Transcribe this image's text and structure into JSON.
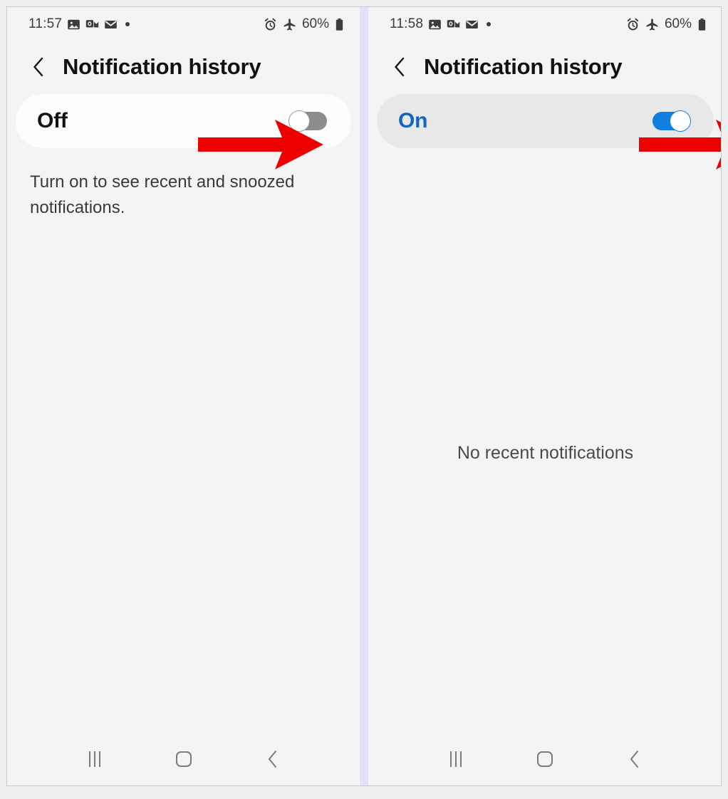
{
  "screenshot": {
    "description": "Two Android (Samsung One UI) phone screenshots side by side showing Notification history settings before and after enabling the toggle",
    "divider_color": "#e3e3f7",
    "accent_blue": "#0f7fe0",
    "arrow_color": "#ee0000"
  },
  "panels": [
    {
      "id": "left",
      "status_bar": {
        "time": "11:57",
        "icons": [
          "gallery-icon",
          "outlook-icon",
          "mail-icon",
          "dot-icon"
        ],
        "right_icons": [
          "alarm-icon",
          "airplane-mode-icon"
        ],
        "battery_percent": "60%",
        "battery_icon": "battery-icon"
      },
      "header": {
        "back_icon": "back-chevron-icon",
        "title": "Notification history"
      },
      "toggle_card": {
        "label": "Off",
        "state": "off",
        "card_background": "#fdfdfd",
        "label_color": "#121212",
        "track_color": "#8d8d8d"
      },
      "description": "Turn on to see recent and snoozed notifications.",
      "empty_state": "",
      "annotation_arrow": "red-arrow-pointing-to-toggle",
      "nav_bar": {
        "recents": "recents-icon",
        "home": "home-icon",
        "back": "back-icon"
      }
    },
    {
      "id": "right",
      "status_bar": {
        "time": "11:58",
        "icons": [
          "gallery-icon",
          "outlook-icon",
          "mail-icon",
          "dot-icon"
        ],
        "right_icons": [
          "alarm-icon",
          "airplane-mode-icon"
        ],
        "battery_percent": "60%",
        "battery_icon": "battery-icon"
      },
      "header": {
        "back_icon": "back-chevron-icon",
        "title": "Notification history"
      },
      "toggle_card": {
        "label": "On",
        "state": "on",
        "card_background": "#e8e8e8",
        "label_color": "#1565c0",
        "track_color": "#0f7fe0"
      },
      "description": "",
      "empty_state": "No recent notifications",
      "annotation_arrow": "red-arrow-pointing-to-toggle",
      "nav_bar": {
        "recents": "recents-icon",
        "home": "home-icon",
        "back": "back-icon"
      }
    }
  ]
}
